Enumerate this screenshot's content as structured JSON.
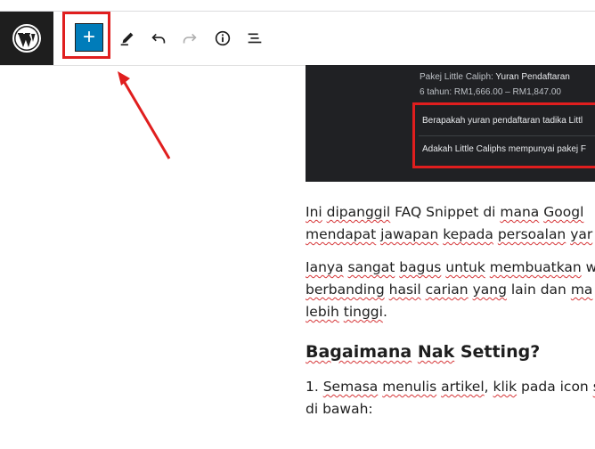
{
  "toolbar": {
    "logo_icon": "wordpress-logo-icon",
    "inserter_label": "+",
    "tools": [
      "edit-pencil-icon",
      "undo-icon",
      "redo-icon",
      "info-icon",
      "list-view-icon"
    ],
    "annotation_color": "#e01e1e",
    "accent_color": "#007cba"
  },
  "screenshot": {
    "line1_prefix": "Pakej Little Caliph: ",
    "line1_bold": "Yuran Pendaftaran",
    "line2": "6 tahun: RM1,666.00 – RM1,847.00",
    "faq1": "Berapakah yuran pendaftaran tadika Littl",
    "faq2": "Adakah Little Caliphs mempunyai pakej F"
  },
  "article": {
    "p1_l1": [
      {
        "t": "Ini",
        "u": true
      },
      {
        "t": " "
      },
      {
        "t": "dipanggil",
        "u": true
      },
      {
        "t": " FAQ Snippet di "
      },
      {
        "t": "mana",
        "u": true
      },
      {
        "t": " "
      },
      {
        "t": "Googl",
        "u": true
      }
    ],
    "p1_l2": [
      {
        "t": "mendapat",
        "u": true
      },
      {
        "t": " "
      },
      {
        "t": "jawapan",
        "u": true
      },
      {
        "t": " "
      },
      {
        "t": "kepada",
        "u": true
      },
      {
        "t": " "
      },
      {
        "t": "persoalan",
        "u": true
      },
      {
        "t": " "
      },
      {
        "t": "yar",
        "u": true
      }
    ],
    "p2_l1": [
      {
        "t": "Ianya",
        "u": true
      },
      {
        "t": " "
      },
      {
        "t": "sangat",
        "u": true
      },
      {
        "t": " "
      },
      {
        "t": "bagus",
        "u": true
      },
      {
        "t": " "
      },
      {
        "t": "untuk",
        "u": true
      },
      {
        "t": " "
      },
      {
        "t": "membuatkan",
        "u": true
      },
      {
        "t": " w"
      }
    ],
    "p2_l2": [
      {
        "t": "berbanding",
        "u": true
      },
      {
        "t": " "
      },
      {
        "t": "hasil",
        "u": true
      },
      {
        "t": " "
      },
      {
        "t": "carian",
        "u": true
      },
      {
        "t": " "
      },
      {
        "t": "yang",
        "u": true
      },
      {
        "t": " lain dan "
      },
      {
        "t": "ma",
        "u": true
      }
    ],
    "p2_l3": [
      {
        "t": "lebih",
        "u": true
      },
      {
        "t": " "
      },
      {
        "t": "tinggi",
        "u": true
      },
      {
        "t": "."
      }
    ],
    "heading": [
      {
        "t": "Bagaimana",
        "u": true
      },
      {
        "t": " "
      },
      {
        "t": "Nak",
        "u": true
      },
      {
        "t": " Setting?"
      }
    ],
    "p3_l1": [
      {
        "t": "1. "
      },
      {
        "t": "Semasa",
        "u": true
      },
      {
        "t": " "
      },
      {
        "t": "menulis",
        "u": true
      },
      {
        "t": " "
      },
      {
        "t": "artikel",
        "u": true
      },
      {
        "t": ", "
      },
      {
        "t": "klik",
        "u": true
      },
      {
        "t": " pada icon "
      },
      {
        "t": "s",
        "u": true
      }
    ],
    "p3_l2": [
      {
        "t": "di bawah:"
      }
    ]
  }
}
